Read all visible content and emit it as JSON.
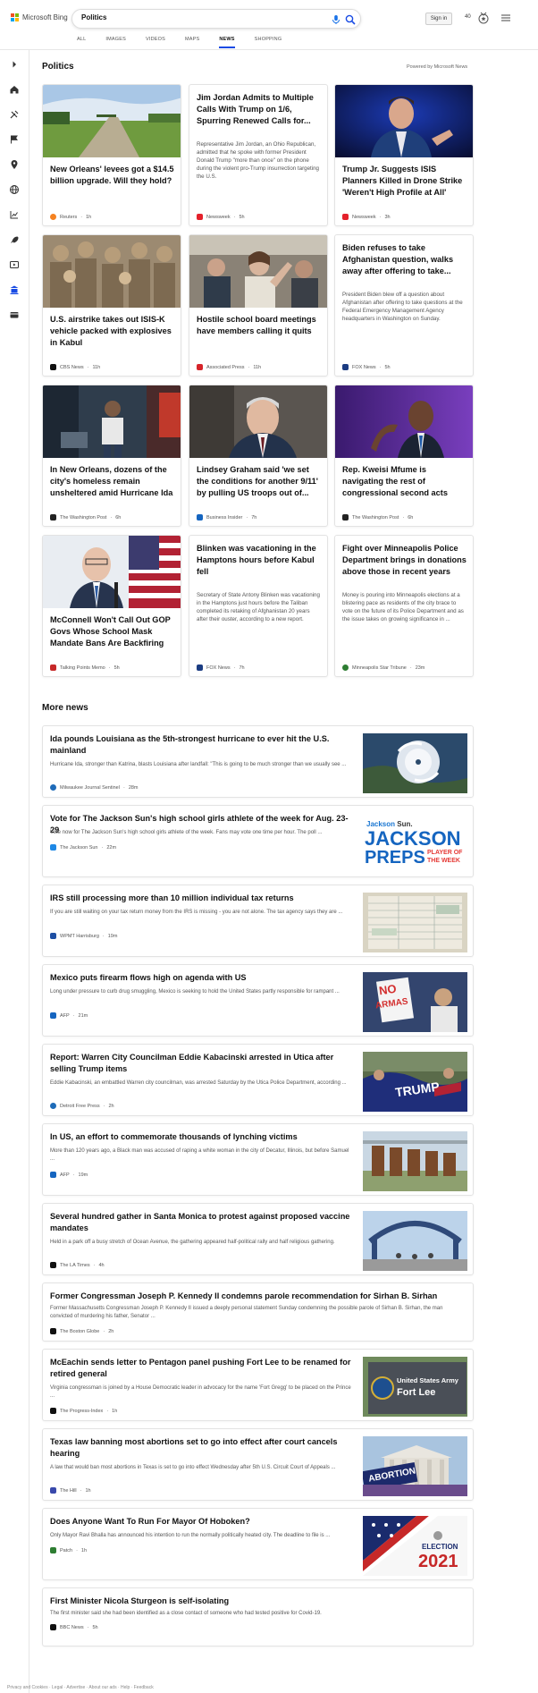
{
  "header": {
    "brand": "Microsoft Bing",
    "query": "Politics",
    "sign_in": "Sign in",
    "rewards_count": "40",
    "tabs": [
      "ALL",
      "IMAGES",
      "VIDEOS",
      "MAPS",
      "NEWS",
      "SHOPPING"
    ],
    "active_tab": "NEWS"
  },
  "politics": {
    "title": "Politics",
    "powered_by": "Powered by Microsoft News",
    "cards": [
      {
        "title": "New Orleans' levees got a $14.5 billion upgrade. Will they hold?",
        "snippet": "",
        "source": "Reuters",
        "time": "1h",
        "icon_color": "#f58220"
      },
      {
        "title": "Jim Jordan Admits to Multiple Calls With Trump on 1/6, Spurring Renewed Calls for...",
        "snippet": "Representative Jim Jordan, an Ohio Republican, admitted that he spoke with former President Donald Trump \"more than once\" on the phone during the violent pro-Trump insurrection targeting the U.S.",
        "source": "Newsweek",
        "time": "5h",
        "icon_color": "#e4212b"
      },
      {
        "title": "Trump Jr. Suggests ISIS Planners Killed in Drone Strike 'Weren't High Profile at All'",
        "snippet": "",
        "source": "Newsweek",
        "time": "3h",
        "icon_color": "#e4212b"
      },
      {
        "title": "U.S. airstrike takes out ISIS-K vehicle packed with explosives in Kabul",
        "snippet": "",
        "source": "CBS News",
        "time": "11h",
        "icon_color": "#111111"
      },
      {
        "title": "Hostile school board meetings have members calling it quits",
        "snippet": "",
        "source": "Associated Press",
        "time": "11h",
        "icon_color": "#d6242a"
      },
      {
        "title": "Biden refuses to take Afghanistan question, walks away after offering to take...",
        "snippet": "President Biden blew off a question about Afghanistan after offering to take questions at the Federal Emergency Management Agency headquarters in Washington on Sunday.",
        "source": "FOX News",
        "time": "5h",
        "icon_color": "#1b3c82"
      },
      {
        "title": "In New Orleans, dozens of the city's homeless remain unsheltered amid Hurricane Ida",
        "snippet": "",
        "source": "The Washington Post",
        "time": "6h",
        "icon_color": "#222222"
      },
      {
        "title": "Lindsey Graham said 'we set the conditions for another 9/11' by pulling US troops out of...",
        "snippet": "",
        "source": "Business Insider",
        "time": "7h",
        "icon_color": "#1565c0"
      },
      {
        "title": "Rep. Kweisi Mfume is navigating the rest of congressional second acts",
        "snippet": "",
        "source": "The Washington Post",
        "time": "6h",
        "icon_color": "#222222"
      },
      {
        "title": "McConnell Won't Call Out GOP Govs Whose School Mask Mandate Bans Are Backfiring",
        "snippet": "",
        "source": "Talking Points Memo",
        "time": "5h",
        "icon_color": "#c62828"
      },
      {
        "title": "Blinken was vacationing in the Hamptons hours before Kabul fell",
        "snippet": "Secretary of State Antony Blinken was vacationing in the Hamptons just hours before the Taliban completed its retaking of Afghanistan 20 years after their ouster, according to a new report.",
        "source": "FOX News",
        "time": "7h",
        "icon_color": "#1b3c82"
      },
      {
        "title": "Fight over Minneapolis Police Department brings in donations above those in recent years",
        "snippet": "Money is pouring into Minneapolis elections at a blistering pace as residents of the city brace to vote on the future of its Police Department and as the issue takes on growing significance in ...",
        "source": "Minneapolis Star Tribune",
        "time": "23m",
        "icon_color": "#2e7d32"
      }
    ]
  },
  "more_news": {
    "title": "More news",
    "items": [
      {
        "title": "Ida pounds Louisiana as the 5th-strongest hurricane to ever hit the U.S. mainland",
        "snippet": "Hurricane Ida, stronger than Katrina, blasts Louisiana after landfall: \"This is going to be much stronger than we usually see ...",
        "source": "Milwaukee Journal Sentinel",
        "time": "28m",
        "icon_color": "#1e6bb8"
      },
      {
        "title": "Vote for The Jackson Sun's high school girls athlete of the week for Aug. 23-29",
        "snippet": "Vote now for The Jackson Sun's high school girls athlete of the week. Fans may vote one time per hour. The poll ...",
        "source": "The Jackson Sun",
        "time": "22m",
        "icon_color": "#1e88e5",
        "thumb_text": [
          "Jackson",
          "Sun.",
          "JACKSON",
          "PREPS",
          "PLAYER OF",
          "THE WEEK"
        ]
      },
      {
        "title": "IRS still processing more than 10 million individual tax returns",
        "snippet": "If you are still waiting on your tax return money from the IRS is missing - you are not alone. The tax agency says they are ...",
        "source": "WPMT Harrisburg",
        "time": "19m",
        "icon_color": "#1e4fa3"
      },
      {
        "title": "Mexico puts firearm flows high on agenda with US",
        "snippet": "Long under pressure to curb drug smuggling, Mexico is seeking to hold the United States partly responsible for rampant ...",
        "source": "AFP",
        "time": "21m",
        "icon_color": "#1565c0",
        "thumb_text": [
          "NO",
          "ARMAS"
        ]
      },
      {
        "title": "Report: Warren City Councilman Eddie Kabacinski arrested in Utica after selling Trump items",
        "snippet": "Eddie Kabacinski, an embattled Warren city councilman, was arrested Saturday by the Utica Police Department, according ...",
        "source": "Detroit Free Press",
        "time": "2h",
        "icon_color": "#1e6bb8",
        "thumb_text": [
          "TRUMP"
        ]
      },
      {
        "title": "In US, an effort to commemorate thousands of lynching victims",
        "snippet": "More than 120 years ago, a Black man was accused of raping a white woman in the city of Decatur, Illinois, but before Samuel ...",
        "source": "AFP",
        "time": "19m",
        "icon_color": "#1565c0"
      },
      {
        "title": "Several hundred gather in Santa Monica to protest against proposed vaccine mandates",
        "snippet": "Held in a park off a busy stretch of Ocean Avenue, the gathering appeared half-political rally and half religious gathering.",
        "source": "The LA Times",
        "time": "4h",
        "icon_color": "#111111"
      },
      {
        "title": "Former Congressman Joseph P. Kennedy II condemns parole recommendation for Sirhan B. Sirhan",
        "snippet": "Former Massachusetts Congressman Joseph P. Kennedy II issued a deeply personal statement Sunday condemning the possible parole of Sirhan B. Sirhan, the man convicted of murdering his father, Senator ...",
        "source": "The Boston Globe",
        "time": "2h",
        "icon_color": "#111111"
      },
      {
        "title": "McEachin sends letter to Pentagon panel pushing Fort Lee to be renamed for retired general",
        "snippet": "Virginia congressman is joined by a House Democratic leader in advocacy for the name 'Fort Gregg' to be placed on the Prince ...",
        "source": "The Progress-Index",
        "time": "1h",
        "icon_color": "#111111",
        "thumb_text": [
          "United States Army",
          "Fort Lee"
        ]
      },
      {
        "title": "Texas law banning most abortions set to go into effect after court cancels hearing",
        "snippet": "A law that would ban most abortions in Texas is set to go into effect Wednesday after 5th U.S. Circuit Court of Appeals ...",
        "source": "The Hill",
        "time": "1h",
        "icon_color": "#3949ab",
        "thumb_text": [
          "ABORTION"
        ]
      },
      {
        "title": "Does Anyone Want To Run For Mayor Of Hoboken?",
        "snippet": "Only Mayor Ravi Bhalla has announced his intention to run the normally politically heated city. The deadline to file is ...",
        "source": "Patch",
        "time": "1h",
        "icon_color": "#2e7d32",
        "thumb_text": [
          "ELECTION",
          "2021"
        ]
      },
      {
        "title": "First Minister Nicola Sturgeon is self-isolating",
        "snippet": "The first minister said she had been identified as a close contact of someone who had tested positive for Covid-19.",
        "source": "BBC News",
        "time": "5h",
        "icon_color": "#111111"
      }
    ]
  },
  "footer": {
    "text": "Privacy and Cookies · Legal · Advertise · About our ads · Help · Feedback"
  }
}
